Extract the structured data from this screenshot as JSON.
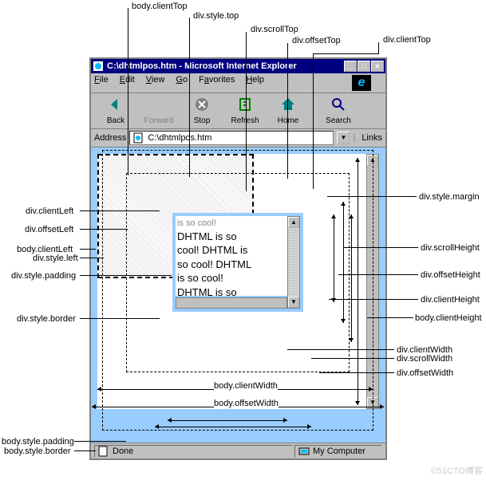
{
  "browser": {
    "title": "C:\\dhtmlpos.htm - Microsoft Internet Explorer",
    "menu": {
      "file": "File",
      "edit": "Edit",
      "view": "View",
      "go": "Go",
      "favorites": "Favorites",
      "help": "Help"
    },
    "toolbar": {
      "back": "Back",
      "forward": "Forward",
      "stop": "Stop",
      "refresh": "Refresh",
      "home": "Home",
      "search": "Search"
    },
    "address_label": "Address",
    "address_value": "C:\\dhtmlpos.htm",
    "links_label": "Links",
    "status_done": "Done",
    "status_zone": "My Computer"
  },
  "content_text": "is so cool!\nDHTML is so\ncool! DHTML is\nso cool! DHTML\nis so cool!\nDHTML is so\ncool! DHTML is",
  "labels": {
    "body_clientTop": "body.clientTop",
    "div_style_top": "div.style.top",
    "div_scrollTop": "div.scrollTop",
    "div_offsetTop": "div.offsetTop",
    "div_clientTop": "div.clientTop",
    "div_style_margin": "div.style.margin",
    "div_clientLeft": "div.clientLeft",
    "div_offsetLeft": "div.offsetLeft",
    "body_clientLeft": "body.clientLeft",
    "div_style_left": "div.style.left",
    "div_style_padding": "div.style.padding",
    "div_style_border": "div.style.border",
    "div_scrollHeight": "div.scrollHeight",
    "div_offsetHeight": "div.offsetHeight",
    "div_clientHeight": "div.clientHeight",
    "body_clientHeight": "body.clientHeight",
    "div_clientWidth": "div.clientWidth",
    "div_scrollWidth": "div.scrollWidth",
    "div_offsetWidth": "div.offsetWidth",
    "body_clientWidth": "body.clientWidth",
    "body_offsetWidth": "body.offsetWidth",
    "body_style_padding": "body.style.padding",
    "body_style_border": "body.style.border"
  },
  "watermark": "©51CTO博客"
}
